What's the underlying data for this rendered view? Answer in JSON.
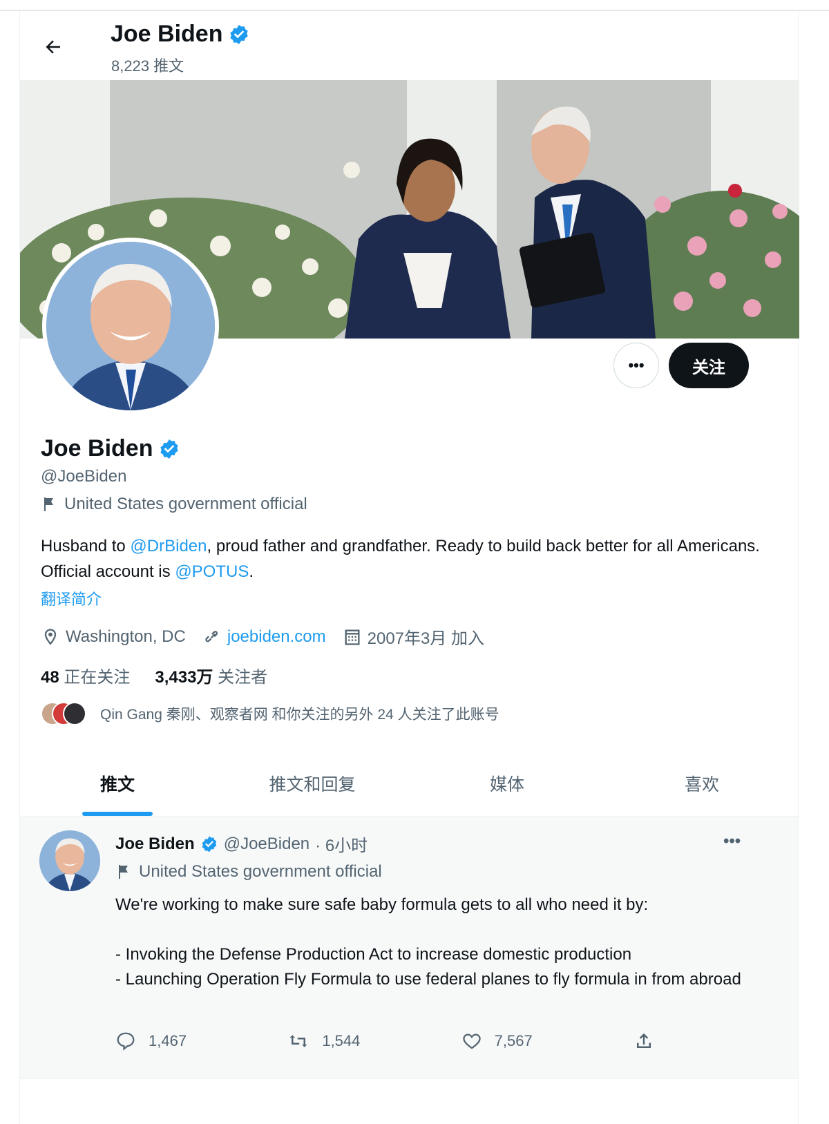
{
  "header": {
    "name": "Joe Biden",
    "tweet_count": "8,223 推文"
  },
  "profile": {
    "name": "Joe Biden",
    "handle": "@JoeBiden",
    "label": "United States government official",
    "bio": {
      "p1": "Husband to ",
      "link1": "@DrBiden",
      "p2": ", proud father and grandfather. Ready to build back better for all Americans. Official account is ",
      "link2": "@POTUS",
      "p3": "."
    },
    "translate": "翻译简介",
    "location": "Washington, DC",
    "website": "joebiden.com",
    "joined": "2007年3月 加入",
    "following_count": "48",
    "following_label": "正在关注",
    "followers_count": "3,433万",
    "followers_label": "关注者",
    "followers_you_know": "Qin Gang 秦刚、观察者网 和你关注的另外 24 人关注了此账号"
  },
  "buttons": {
    "more": "•••",
    "follow": "关注"
  },
  "tabs": [
    {
      "label": "推文"
    },
    {
      "label": "推文和回复"
    },
    {
      "label": "媒体"
    },
    {
      "label": "喜欢"
    }
  ],
  "tweet": {
    "name": "Joe Biden",
    "handle": "@JoeBiden",
    "time": "· 6小时",
    "label": "United States government official",
    "text": "We're working to make sure safe baby formula gets to all who need it by:\n\n- Invoking the Defense Production Act to increase domestic production\n- Launching Operation Fly Formula to use federal planes to fly formula in from abroad",
    "replies": "1,467",
    "retweets": "1,544",
    "likes": "7,567",
    "more": "•••"
  },
  "colors": {
    "accent": "#1d9bf0",
    "text": "#0f1419",
    "secondary": "#536471"
  }
}
